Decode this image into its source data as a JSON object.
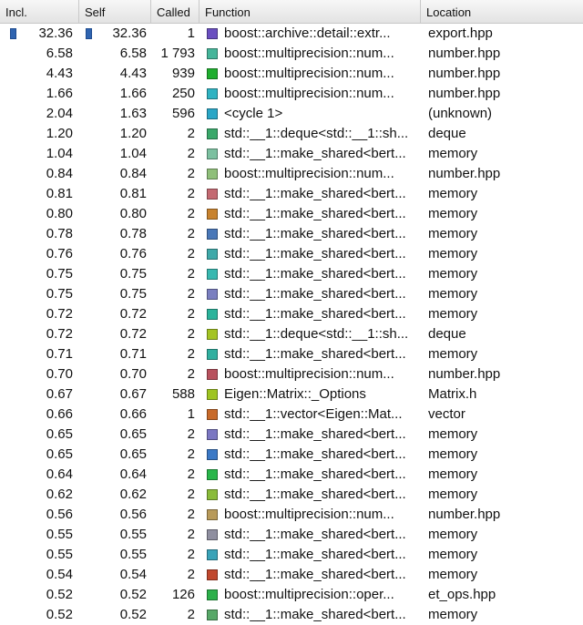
{
  "columns": {
    "incl": "Incl.",
    "self": "Self",
    "called": "Called",
    "function": "Function",
    "location": "Location"
  },
  "rows": [
    {
      "incl": "32.36",
      "self": "32.36",
      "called": "1",
      "function": "boost::archive::detail::extr...",
      "location": "export.hpp",
      "color": "#6a4fc0",
      "selected": true
    },
    {
      "incl": "6.58",
      "self": "6.58",
      "called": "1 793",
      "function": "boost::multiprecision::num...",
      "location": "number.hpp",
      "color": "#45b59a"
    },
    {
      "incl": "4.43",
      "self": "4.43",
      "called": "939",
      "function": "boost::multiprecision::num...",
      "location": "number.hpp",
      "color": "#1fae2f"
    },
    {
      "incl": "1.66",
      "self": "1.66",
      "called": "250",
      "function": "boost::multiprecision::num...",
      "location": "number.hpp",
      "color": "#2fb3c2"
    },
    {
      "incl": "2.04",
      "self": "1.63",
      "called": "596",
      "function": "<cycle 1>",
      "location": "(unknown)",
      "color": "#2aa6c6"
    },
    {
      "incl": "1.20",
      "self": "1.20",
      "called": "2",
      "function": "std::__1::deque<std::__1::sh...",
      "location": "deque",
      "color": "#3aa86a"
    },
    {
      "incl": "1.04",
      "self": "1.04",
      "called": "2",
      "function": "std::__1::make_shared<bert...",
      "location": "memory",
      "color": "#7cc0a0"
    },
    {
      "incl": "0.84",
      "self": "0.84",
      "called": "2",
      "function": "boost::multiprecision::num...",
      "location": "number.hpp",
      "color": "#8fbf7a"
    },
    {
      "incl": "0.81",
      "self": "0.81",
      "called": "2",
      "function": "std::__1::make_shared<bert...",
      "location": "memory",
      "color": "#c46a72"
    },
    {
      "incl": "0.80",
      "self": "0.80",
      "called": "2",
      "function": "std::__1::make_shared<bert...",
      "location": "memory",
      "color": "#c8832f"
    },
    {
      "incl": "0.78",
      "self": "0.78",
      "called": "2",
      "function": "std::__1::make_shared<bert...",
      "location": "memory",
      "color": "#4a78b8"
    },
    {
      "incl": "0.76",
      "self": "0.76",
      "called": "2",
      "function": "std::__1::make_shared<bert...",
      "location": "memory",
      "color": "#3fa9a9"
    },
    {
      "incl": "0.75",
      "self": "0.75",
      "called": "2",
      "function": "std::__1::make_shared<bert...",
      "location": "memory",
      "color": "#38b8b0"
    },
    {
      "incl": "0.75",
      "self": "0.75",
      "called": "2",
      "function": "std::__1::make_shared<bert...",
      "location": "memory",
      "color": "#7a7fc0"
    },
    {
      "incl": "0.72",
      "self": "0.72",
      "called": "2",
      "function": "std::__1::make_shared<bert...",
      "location": "memory",
      "color": "#2bb39b"
    },
    {
      "incl": "0.72",
      "self": "0.72",
      "called": "2",
      "function": "std::__1::deque<std::__1::sh...",
      "location": "deque",
      "color": "#a4c423"
    },
    {
      "incl": "0.71",
      "self": "0.71",
      "called": "2",
      "function": "std::__1::make_shared<bert...",
      "location": "memory",
      "color": "#31b0a0"
    },
    {
      "incl": "0.70",
      "self": "0.70",
      "called": "2",
      "function": "boost::multiprecision::num...",
      "location": "number.hpp",
      "color": "#b8525e"
    },
    {
      "incl": "0.67",
      "self": "0.67",
      "called": "588",
      "function": "Eigen::Matrix::_Options",
      "location": "Matrix.h",
      "color": "#9ec421"
    },
    {
      "incl": "0.66",
      "self": "0.66",
      "called": "1",
      "function": "std::__1::vector<Eigen::Mat...",
      "location": "vector",
      "color": "#c86a2a"
    },
    {
      "incl": "0.65",
      "self": "0.65",
      "called": "2",
      "function": "std::__1::make_shared<bert...",
      "location": "memory",
      "color": "#7b77c2"
    },
    {
      "incl": "0.65",
      "self": "0.65",
      "called": "2",
      "function": "std::__1::make_shared<bert...",
      "location": "memory",
      "color": "#3b79c6"
    },
    {
      "incl": "0.64",
      "self": "0.64",
      "called": "2",
      "function": "std::__1::make_shared<bert...",
      "location": "memory",
      "color": "#29b64a"
    },
    {
      "incl": "0.62",
      "self": "0.62",
      "called": "2",
      "function": "std::__1::make_shared<bert...",
      "location": "memory",
      "color": "#8abb3a"
    },
    {
      "incl": "0.56",
      "self": "0.56",
      "called": "2",
      "function": "boost::multiprecision::num...",
      "location": "number.hpp",
      "color": "#b89a5a"
    },
    {
      "incl": "0.55",
      "self": "0.55",
      "called": "2",
      "function": "std::__1::make_shared<bert...",
      "location": "memory",
      "color": "#8f8fa0"
    },
    {
      "incl": "0.55",
      "self": "0.55",
      "called": "2",
      "function": "std::__1::make_shared<bert...",
      "location": "memory",
      "color": "#3aa3b8"
    },
    {
      "incl": "0.54",
      "self": "0.54",
      "called": "2",
      "function": "std::__1::make_shared<bert...",
      "location": "memory",
      "color": "#c0482e"
    },
    {
      "incl": "0.52",
      "self": "0.52",
      "called": "126",
      "function": "boost::multiprecision::oper...",
      "location": "et_ops.hpp",
      "color": "#2cb04a"
    },
    {
      "incl": "0.52",
      "self": "0.52",
      "called": "2",
      "function": "std::__1::make_shared<bert...",
      "location": "memory",
      "color": "#58a868"
    }
  ]
}
